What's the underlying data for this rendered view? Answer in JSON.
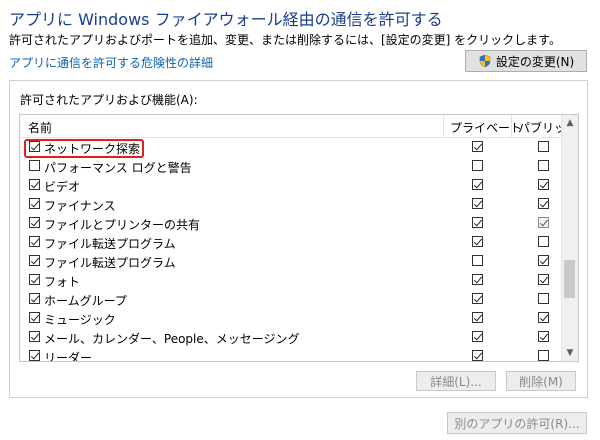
{
  "title": "アプリに Windows ファイアウォール経由の通信を許可する",
  "description": "許可されたアプリおよびポートを追加、変更、または削除するには、[設定の変更] をクリックします。",
  "risk_link": "アプリに通信を許可する危険性の詳細",
  "change_settings_button": "設定の変更(N)",
  "group_label": "許可されたアプリおよび機能(A):",
  "columns": {
    "name": "名前",
    "private": "プライベート",
    "public": "パブリック"
  },
  "rows": [
    {
      "name": "ネットワーク探索",
      "enabled": true,
      "private": true,
      "public": false,
      "highlighted": true
    },
    {
      "name": "パフォーマンス ログと警告",
      "enabled": false,
      "private": false,
      "public": false
    },
    {
      "name": "ビデオ",
      "enabled": true,
      "private": true,
      "public": true
    },
    {
      "name": "ファイナンス",
      "enabled": true,
      "private": true,
      "public": true
    },
    {
      "name": "ファイルとプリンターの共有",
      "enabled": true,
      "private": true,
      "public": true,
      "public_gray": true
    },
    {
      "name": "ファイル転送プログラム",
      "enabled": true,
      "private": true,
      "public": false
    },
    {
      "name": "ファイル転送プログラム",
      "enabled": true,
      "private": false,
      "public": true
    },
    {
      "name": "フォト",
      "enabled": true,
      "private": true,
      "public": true
    },
    {
      "name": "ホームグループ",
      "enabled": true,
      "private": true,
      "public": false
    },
    {
      "name": "ミュージック",
      "enabled": true,
      "private": true,
      "public": true
    },
    {
      "name": "メール、カレンダー、People、メッセージング",
      "enabled": true,
      "private": true,
      "public": true
    },
    {
      "name": "リーダー",
      "enabled": true,
      "private": true,
      "public": false
    }
  ],
  "details_button": "詳細(L)...",
  "remove_button": "削除(M)",
  "allow_other_button": "別のアプリの許可(R)...",
  "icons": {
    "shield": "uac-shield-icon",
    "scroll_up": "chevron-up-icon",
    "scroll_down": "chevron-down-icon"
  },
  "colors": {
    "title": "#1a3e8c",
    "link": "#0b63b6",
    "highlight": "#e02020"
  }
}
